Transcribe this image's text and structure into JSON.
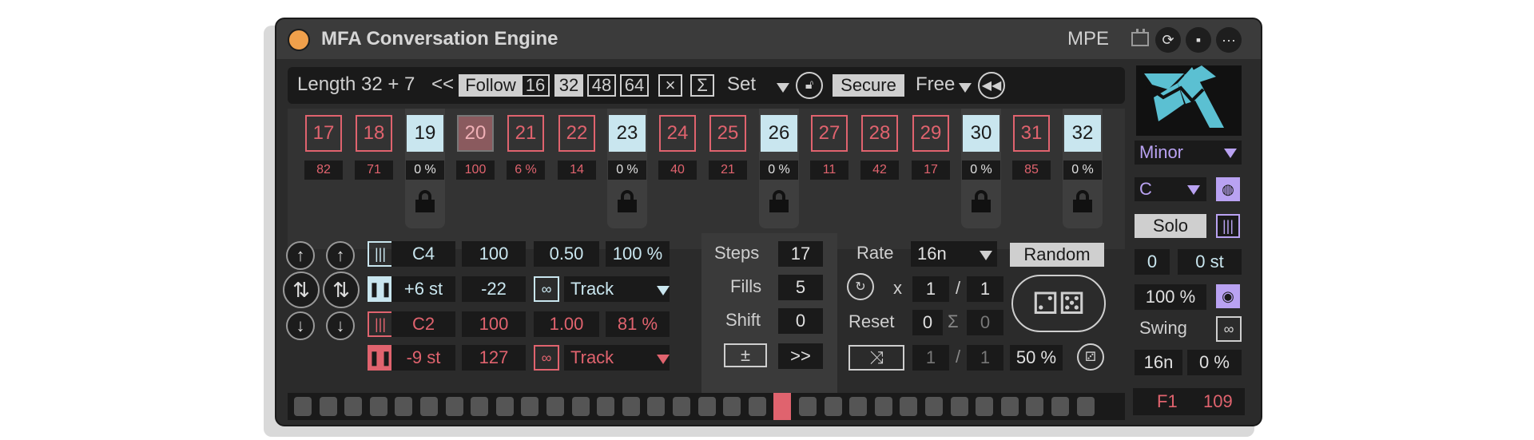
{
  "title": "MFA Conversation Engine",
  "mpe": "MPE",
  "toolbar": {
    "length_label": "Length",
    "length_value": "32 + 7",
    "back": "<<",
    "follow": "Follow",
    "len16": "16",
    "len32": "32",
    "len48": "48",
    "len64": "64",
    "clear": "×",
    "sigma": "Σ",
    "set": "Set",
    "secure": "Secure",
    "free": "Free"
  },
  "steps": [
    {
      "n": "17",
      "v": "82",
      "type": "red"
    },
    {
      "n": "18",
      "v": "71",
      "type": "red"
    },
    {
      "n": "19",
      "v": "0 %",
      "type": "blue"
    },
    {
      "n": "20",
      "v": "100",
      "type": "sel"
    },
    {
      "n": "21",
      "v": "6 %",
      "type": "red"
    },
    {
      "n": "22",
      "v": "14",
      "type": "red"
    },
    {
      "n": "23",
      "v": "0 %",
      "type": "blue"
    },
    {
      "n": "24",
      "v": "40",
      "type": "red"
    },
    {
      "n": "25",
      "v": "21",
      "type": "red"
    },
    {
      "n": "26",
      "v": "0 %",
      "type": "blue"
    },
    {
      "n": "27",
      "v": "11",
      "type": "red"
    },
    {
      "n": "28",
      "v": "42",
      "type": "red"
    },
    {
      "n": "29",
      "v": "17",
      "type": "red"
    },
    {
      "n": "30",
      "v": "0 %",
      "type": "blue"
    },
    {
      "n": "31",
      "v": "85",
      "type": "red"
    },
    {
      "n": "32",
      "v": "0 %",
      "type": "blue"
    }
  ],
  "voice1": {
    "note": "C4",
    "vel": "100",
    "len": "0.50",
    "pct": "100 %",
    "trans": "+6 st",
    "val2": "-22",
    "mode": "Track"
  },
  "voice2": {
    "note": "C2",
    "vel": "100",
    "len": "1.00",
    "pct": "81 %",
    "trans": "-9 st",
    "val2": "127",
    "mode": "Track"
  },
  "mid": {
    "steps_label": "Steps",
    "steps": "17",
    "fills_label": "Fills",
    "fills": "5",
    "shift_label": "Shift",
    "shift": "0",
    "pm": "±",
    "fwd": ">>"
  },
  "rate": {
    "rate_label": "Rate",
    "rate": "16n",
    "random": "Random",
    "x": "x",
    "m1": "1",
    "slash": "/",
    "d1": "1",
    "reset_label": "Reset",
    "reset": "0",
    "sigma": "Σ",
    "reset2": "0",
    "m2": "1",
    "d2": "1",
    "pct": "50 %"
  },
  "right": {
    "scale": "Minor",
    "key": "C",
    "solo": "Solo",
    "v1": "0",
    "v2": "0 st",
    "v3": "100 %",
    "swing_label": "Swing",
    "swing_rate": "16n",
    "swing_pct": "0 %"
  },
  "footer": {
    "f1": "F1",
    "val": "109"
  },
  "colors": {
    "red": "#e0636e",
    "blue": "#c9e6ef",
    "purple": "#b9a2f2",
    "orange": "#f0a04b"
  }
}
